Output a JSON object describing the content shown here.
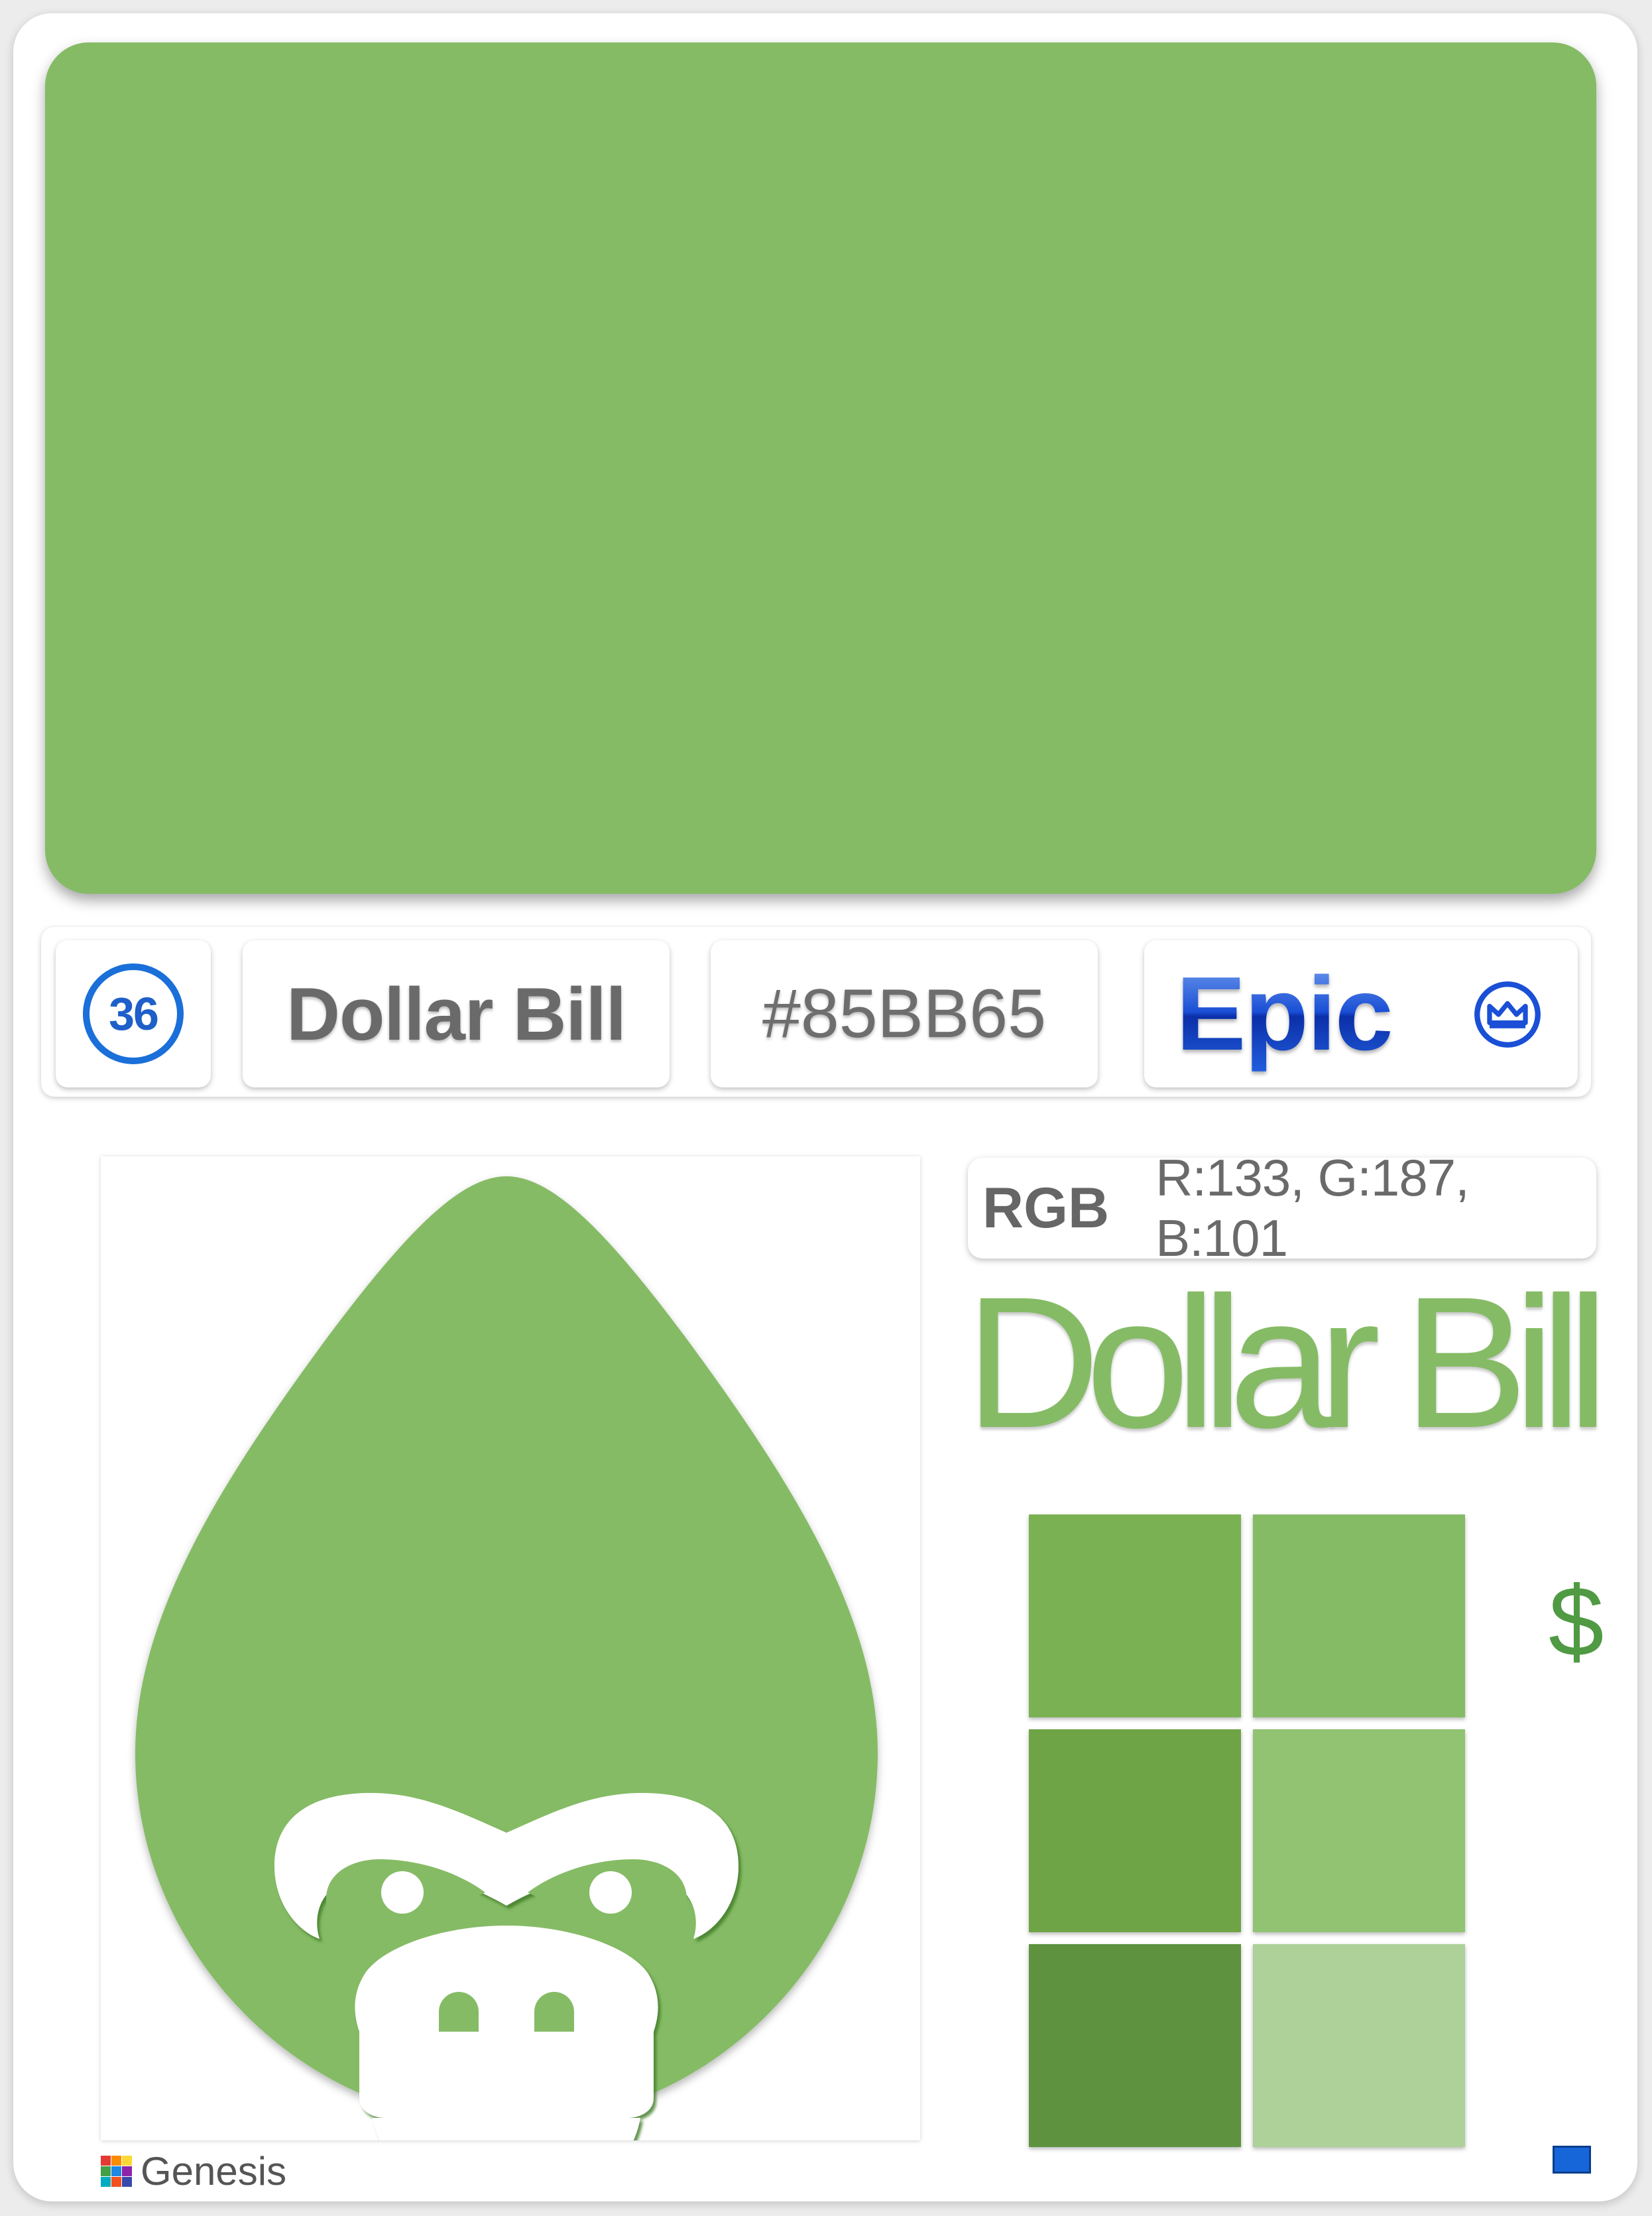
{
  "card": {
    "number": "36",
    "name": "Dollar Bill",
    "hex": "#85BB65",
    "rarity": "Epic",
    "rarity_icon": "crown-icon",
    "rgb_label": "RGB",
    "rgb_values": "R:133, G:187, B:101",
    "title_big": "Dollar Bill",
    "symbol": "$",
    "symbol_icon": "dollar-icon",
    "logo_icon": "gorilla-drop-icon",
    "brand": "Genesis",
    "brand_icon": "grid-logo-icon"
  },
  "colors": {
    "main": "#85BB65",
    "accent_blue": "#1A6FD9",
    "shades": [
      "#79B153",
      "#86BB66",
      "#6EA446",
      "#92C373",
      "#5E923F",
      "#ADD199"
    ]
  }
}
